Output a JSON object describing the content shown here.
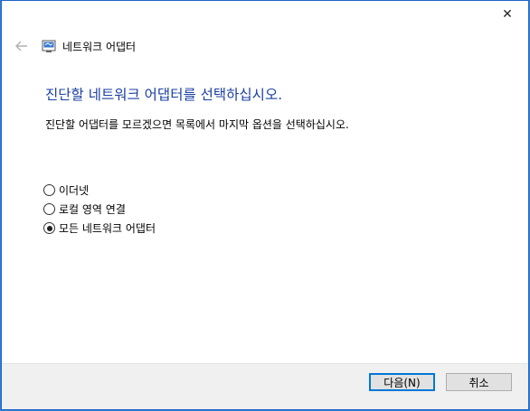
{
  "window": {
    "title": "네트워크 어댑터",
    "close_glyph": "✕"
  },
  "nav": {
    "back_glyph": "←"
  },
  "content": {
    "heading": "진단할 네트워크 어댑터를 선택하십시오.",
    "instruction": "진단할 어댑터를 모르겠으면 목록에서 마지막 옵션을 선택하십시오.",
    "options": [
      {
        "label": "이더넷",
        "selected": false
      },
      {
        "label": "로컬 영역 연결",
        "selected": false
      },
      {
        "label": "모든 네트워크 어댑터",
        "selected": true
      }
    ]
  },
  "footer": {
    "next_label": "다음(N)",
    "cancel_label": "취소"
  },
  "colors": {
    "heading": "#1a3fa0",
    "accent": "#0078d7",
    "desktop": "#2f7fd3"
  }
}
